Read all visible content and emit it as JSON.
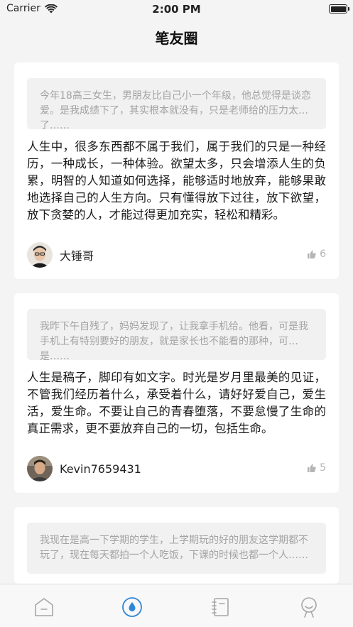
{
  "status_bar": {
    "carrier": "Carrier",
    "time": "2:00 PM"
  },
  "nav": {
    "title": "笔友圈"
  },
  "posts": [
    {
      "quote": "今年18高三女生，男朋友比自己小一个年级，他总觉得是谈恋爱。是我成绩下了，其实根本就没有，只是老师给的压力太大了……",
      "body": "人生中，很多东西都不属于我们，属于我们的只是一种经历，一种成长，一种体验。欲望太多，只会增添人生的负累，明智的人知道如何选择，能够适时地放弃，能够果敢地选择自己的人生方向。只有懂得放下过往，放下欲望，放下贪婪的人，才能过得更加充实，轻松和精彩。",
      "author": "大锤哥",
      "likes": "6"
    },
    {
      "quote": "我昨下午自残了，妈妈发现了，让我拿手机给。他看，可是我手机上有特别要好的朋友，就是家长也不能看的那种，可是……",
      "body": "人生是稿子，脚印有如文字。时光是岁月里最美的见证，不管我们经历着什么，承受着什么，请好好爱自己，爱生活，爱生命。不要让自己的青春堕落，不要怠慢了生命的真正需求，更不要放弃自己的一切，包括生命。",
      "author": "Kevin7659431",
      "likes": "5"
    },
    {
      "quote": "我现在是高一下学期的学生，上学期玩的好的朋友这学期都不玩了，现在每天都拍一个人吃饭，下课的时候也都一个人……",
      "body": "",
      "author": "",
      "likes": ""
    }
  ],
  "tab_bar": {
    "items": [
      {
        "icon": "home-icon",
        "active": false
      },
      {
        "icon": "drop-circle-icon",
        "active": true
      },
      {
        "icon": "notebook-icon",
        "active": false
      },
      {
        "icon": "profile-icon",
        "active": false
      }
    ],
    "active_color": "#2f86d8",
    "inactive_color": "#a6a6a6"
  }
}
